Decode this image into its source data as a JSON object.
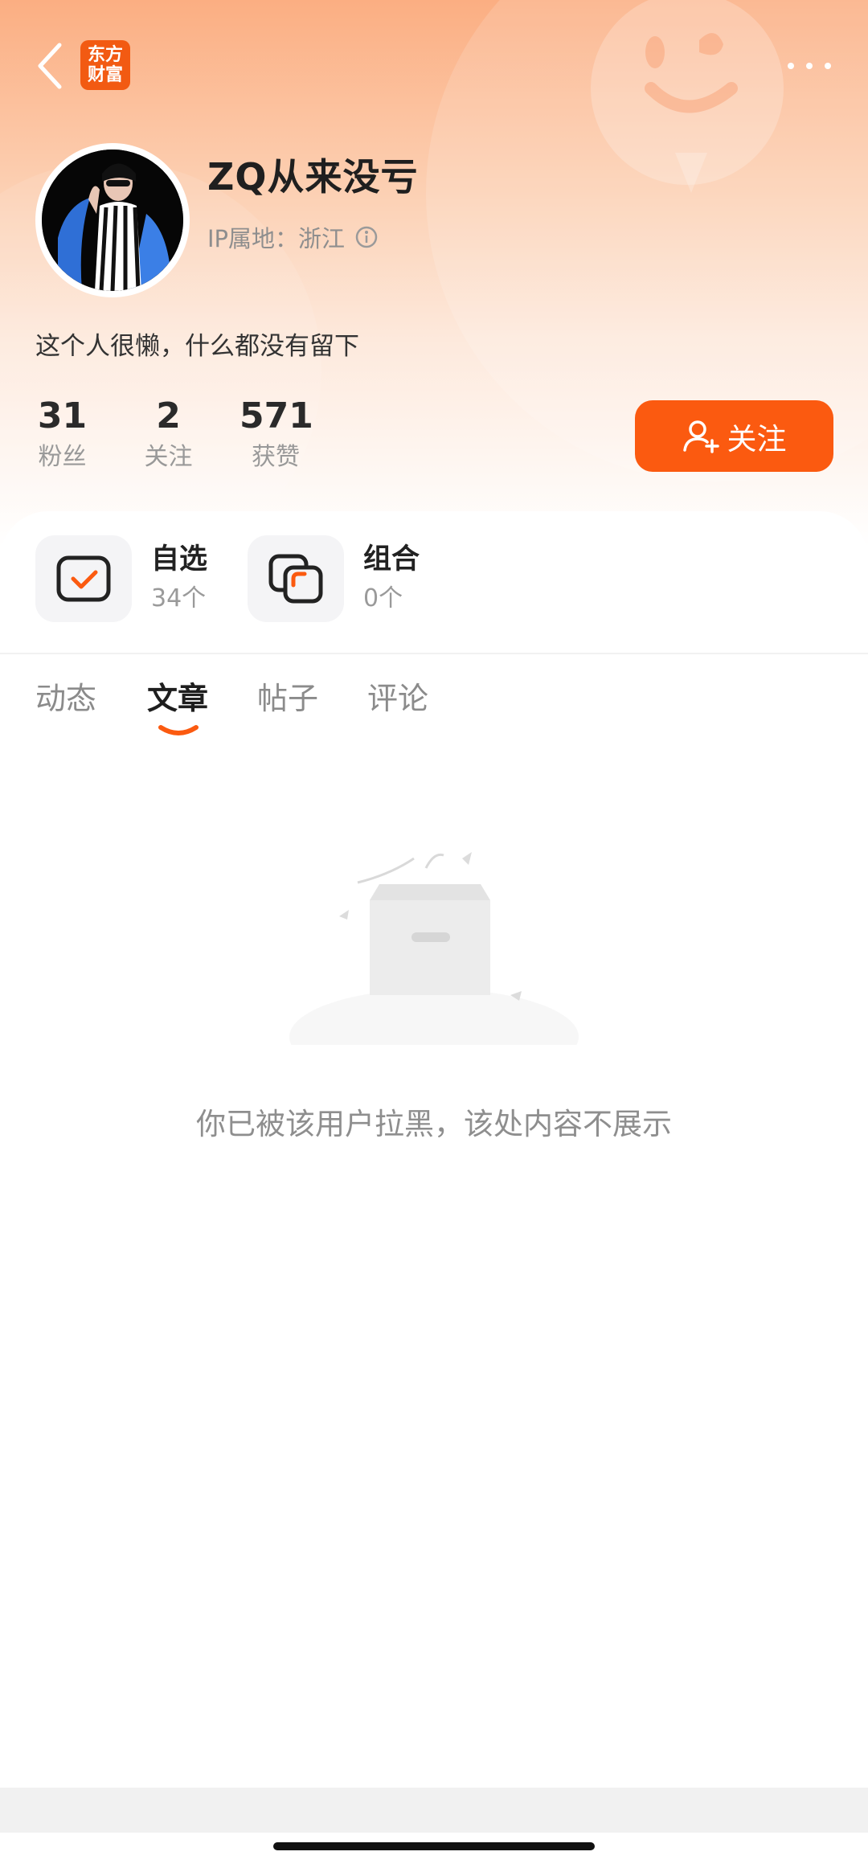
{
  "header": {
    "logo_line1": "东方",
    "logo_line2": "财富"
  },
  "profile": {
    "username": "ZQ从来没亏",
    "ip_location": "IP属地：浙江",
    "bio": "这个人很懒，什么都没有留下"
  },
  "stats": [
    {
      "value": "31",
      "label": "粉丝"
    },
    {
      "value": "2",
      "label": "关注"
    },
    {
      "value": "571",
      "label": "获赞"
    }
  ],
  "follow_button": {
    "label": "关注"
  },
  "features": [
    {
      "title": "自选",
      "count": "34个"
    },
    {
      "title": "组合",
      "count": "0个"
    }
  ],
  "tabs": [
    {
      "label": "动态"
    },
    {
      "label": "文章"
    },
    {
      "label": "帖子"
    },
    {
      "label": "评论"
    }
  ],
  "active_tab": "文章",
  "empty_state": {
    "message": "你已被该用户拉黑，该处内容不展示"
  },
  "colors": {
    "accent": "#fb5a10",
    "header_gradient_top": "#fbae82"
  }
}
